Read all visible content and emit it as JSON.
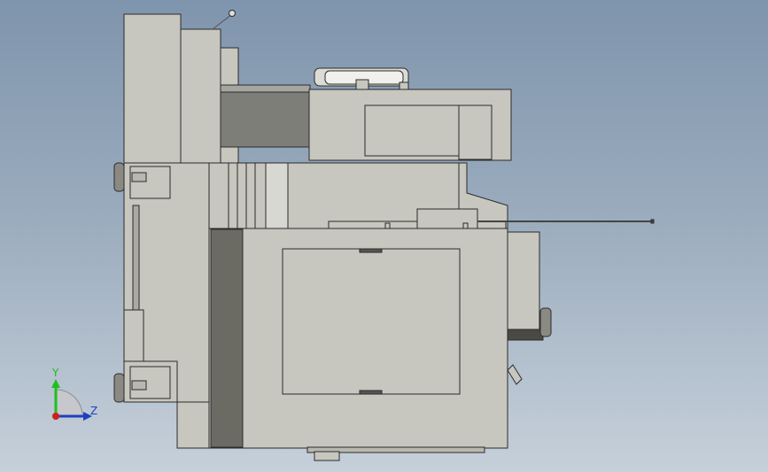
{
  "viewport": {
    "background_top": "#7f95ad",
    "background_bottom": "#c6d0da",
    "part_face_color": "#c7c7bf",
    "part_edge_color": "#2b2b2b",
    "part_shadow_color": "#6b6b63"
  },
  "triad": {
    "y_label": "Y",
    "z_label": "Z",
    "y_color": "#1fbf1f",
    "z_color": "#1f3fbf",
    "x_color": "#d01f1f"
  }
}
